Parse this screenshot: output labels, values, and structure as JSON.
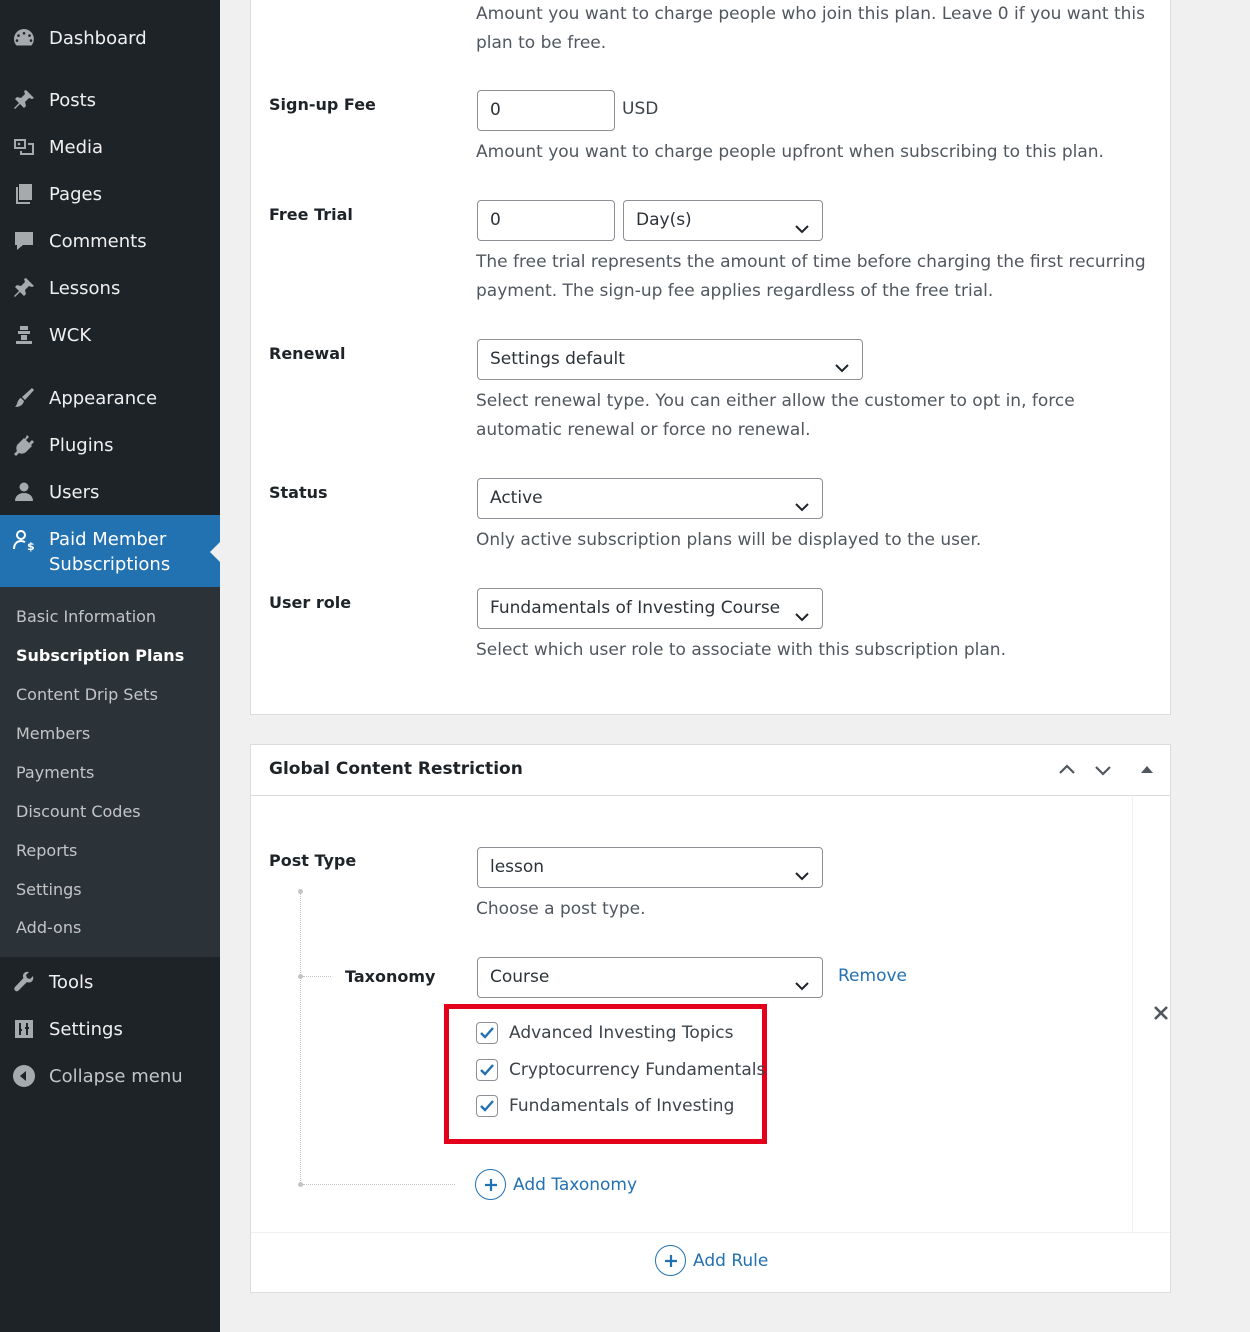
{
  "sidebar": {
    "menu": {
      "dashboard": "Dashboard",
      "posts": "Posts",
      "media": "Media",
      "pages": "Pages",
      "comments": "Comments",
      "lessons": "Lessons",
      "wck": "WCK",
      "appearance": "Appearance",
      "plugins": "Plugins",
      "users": "Users",
      "pms_line1": "Paid Member",
      "pms_line2": "Subscriptions",
      "tools": "Tools",
      "settings": "Settings",
      "collapse": "Collapse menu"
    },
    "submenu": {
      "basic_information": "Basic Information",
      "subscription_plans": "Subscription Plans",
      "content_drip_sets": "Content Drip Sets",
      "members": "Members",
      "payments": "Payments",
      "discount_codes": "Discount Codes",
      "reports": "Reports",
      "settings": "Settings",
      "add_ons": "Add-ons"
    }
  },
  "plan": {
    "price_desc_line1": "Amount you want to charge people who join this plan. Leave 0 if you want this",
    "price_desc_line2": "plan to be free.",
    "signup_fee": {
      "label": "Sign-up Fee",
      "value": "0",
      "unit": "USD",
      "desc": "Amount you want to charge people upfront when subscribing to this plan."
    },
    "free_trial": {
      "label": "Free Trial",
      "value": "0",
      "unit_select": "Day(s)",
      "desc_line1": "The free trial represents the amount of time before charging the first recurring",
      "desc_line2": "payment. The sign-up fee applies regardless of the free trial."
    },
    "renewal": {
      "label": "Renewal",
      "value": "Settings default",
      "desc_line1": "Select renewal type. You can either allow the customer to opt in, force",
      "desc_line2": "automatic renewal or force no renewal."
    },
    "status": {
      "label": "Status",
      "value": "Active",
      "desc": "Only active subscription plans will be displayed to the user."
    },
    "user_role": {
      "label": "User role",
      "value": "Fundamentals of Investing Course",
      "desc": "Select which user role to associate with this subscription plan."
    }
  },
  "gcr": {
    "title": "Global Content Restriction",
    "post_type": {
      "label": "Post Type",
      "value": "lesson",
      "desc": "Choose a post type."
    },
    "taxonomy": {
      "label": "Taxonomy",
      "value": "Course",
      "remove": "Remove",
      "terms": [
        {
          "label": "Advanced Investing Topics",
          "checked": true
        },
        {
          "label": "Cryptocurrency Fundamentals",
          "checked": true
        },
        {
          "label": "Fundamentals of Investing",
          "checked": true
        }
      ]
    },
    "add_taxonomy": "Add Taxonomy",
    "add_rule": "Add Rule"
  },
  "colors": {
    "sidebar_bg": "#1d2327",
    "submenu_bg": "#2c3338",
    "accent": "#2271b1",
    "highlight": "#e4001b"
  }
}
